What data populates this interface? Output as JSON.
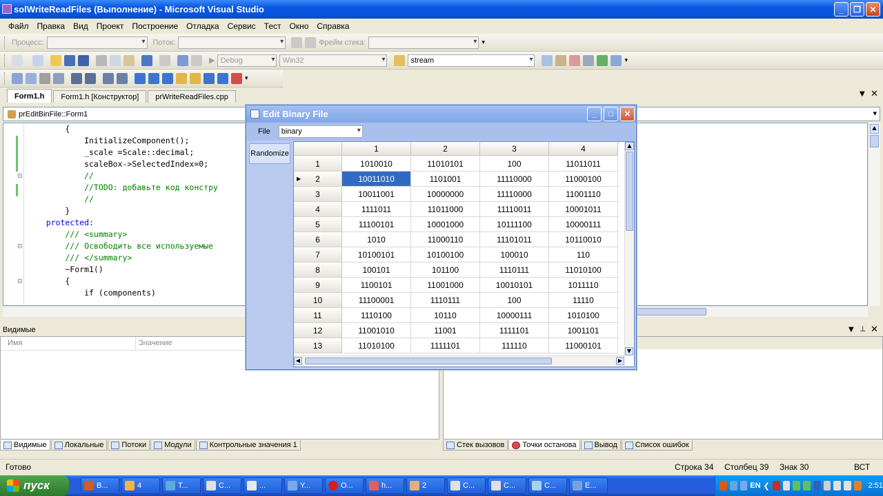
{
  "window": {
    "title": "solWriteReadFiles (Выполнение) - Microsoft Visual Studio"
  },
  "menu": [
    "Файл",
    "Правка",
    "Вид",
    "Проект",
    "Построение",
    "Отладка",
    "Сервис",
    "Тест",
    "Окно",
    "Справка"
  ],
  "toolbar1": {
    "process_label": "Процесс:",
    "thread_label": "Поток:",
    "stack_label": "Фрейм стека:"
  },
  "toolbar2": {
    "config": "Debug",
    "platform": "Win32",
    "search": "stream"
  },
  "doc_tabs": [
    "Form1.h",
    "Form1.h [Конструктор]",
    "prWriteReadFiles.cpp"
  ],
  "editor": {
    "member_combo": "prEditBinFile::Form1",
    "lines": [
      {
        "t": "        {",
        "c": "n"
      },
      {
        "t": "            InitializeComponent();",
        "c": "n"
      },
      {
        "t": "            _scale =Scale::decimal;",
        "c": "n"
      },
      {
        "t": "            scaleBox->SelectedIndex=0;",
        "c": "n"
      },
      {
        "t": "            //",
        "c": "cm"
      },
      {
        "t": "            //TODO: добавьте код констру",
        "c": "cm"
      },
      {
        "t": "            //",
        "c": "cm"
      },
      {
        "t": "        }",
        "c": "n"
      },
      {
        "t": "",
        "c": "n"
      },
      {
        "t": "    protected:",
        "c": "kw"
      },
      {
        "t": "        /// <summary>",
        "c": "cm"
      },
      {
        "t": "        /// Освободить все используемые",
        "c": "cm"
      },
      {
        "t": "        /// </summary>",
        "c": "cm"
      },
      {
        "t": "        ~Form1()",
        "c": "n"
      },
      {
        "t": "        {",
        "c": "n"
      },
      {
        "t": "            if (components)",
        "c": "n"
      }
    ]
  },
  "locals_panel": {
    "title": "Видимые",
    "col_name": "Имя",
    "col_value": "Значение"
  },
  "bottom_left_tabs": [
    "Видимые",
    "Локальные",
    "Потоки",
    "Модули",
    "Контрольные значения 1"
  ],
  "bottom_right_tabs": [
    "Стек вызовов",
    "Точки останова",
    "Вывод",
    "Список ошибок"
  ],
  "status": {
    "ready": "Готово",
    "line": "Строка 34",
    "col": "Столбец 39",
    "char": "Знак 30",
    "mode": "ВСТ"
  },
  "taskbar": {
    "start": "пуск",
    "buttons": [
      "В...",
      "4",
      "Т...",
      "С...",
      "...",
      "Y...",
      "О...",
      "h...",
      "2",
      "С...",
      "С...",
      "С...",
      "E..."
    ],
    "lang": "EN",
    "clock": "2:51"
  },
  "dialog": {
    "title": "Edit Binary File",
    "file_label": "File",
    "file_combo": "binary",
    "randomize_label": "Randomize",
    "columns": [
      "1",
      "2",
      "3",
      "4"
    ],
    "rows": [
      {
        "n": "1",
        "v": [
          "1010010",
          "11010101",
          "100",
          "11011011"
        ]
      },
      {
        "n": "2",
        "v": [
          "10011010",
          "1101001",
          "11110000",
          "11000100"
        ]
      },
      {
        "n": "3",
        "v": [
          "10011001",
          "10000000",
          "11110000",
          "11001110"
        ]
      },
      {
        "n": "4",
        "v": [
          "1111011",
          "11011000",
          "11110011",
          "10001011"
        ]
      },
      {
        "n": "5",
        "v": [
          "11100101",
          "10001000",
          "10111100",
          "10000111"
        ]
      },
      {
        "n": "6",
        "v": [
          "1010",
          "11000110",
          "11101011",
          "10110010"
        ]
      },
      {
        "n": "7",
        "v": [
          "10100101",
          "10100100",
          "100010",
          "110"
        ]
      },
      {
        "n": "8",
        "v": [
          "100101",
          "101100",
          "1110111",
          "11010100"
        ]
      },
      {
        "n": "9",
        "v": [
          "1100101",
          "11001000",
          "10010101",
          "1011110"
        ]
      },
      {
        "n": "10",
        "v": [
          "11100001",
          "1110111",
          "100",
          "11110"
        ]
      },
      {
        "n": "11",
        "v": [
          "1110100",
          "10110",
          "10000111",
          "1010100"
        ]
      },
      {
        "n": "12",
        "v": [
          "11001010",
          "11001",
          "1111101",
          "1001101"
        ]
      },
      {
        "n": "13",
        "v": [
          "11010100",
          "1111101",
          "111110",
          "11000101"
        ]
      }
    ]
  }
}
